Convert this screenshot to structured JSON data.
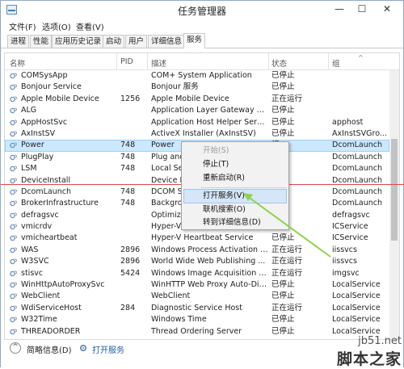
{
  "window": {
    "title": "任务管理器",
    "controls": {
      "minimize": "—",
      "maximize": "☐",
      "close": "✕"
    }
  },
  "menubar": [
    "文件(F)",
    "选项(O)",
    "查看(V)"
  ],
  "tabs": [
    {
      "label": "进程",
      "active": false
    },
    {
      "label": "性能",
      "active": false
    },
    {
      "label": "应用历史记录",
      "active": false
    },
    {
      "label": "启动",
      "active": false
    },
    {
      "label": "用户",
      "active": false
    },
    {
      "label": "详细信息",
      "active": false
    },
    {
      "label": "服务",
      "active": true
    }
  ],
  "columns": {
    "name": "名称",
    "pid": "PID",
    "desc": "描述",
    "status": "状态",
    "group": "组"
  },
  "rows": [
    {
      "name": "COMSysApp",
      "pid": "",
      "desc": "COM+ System Application",
      "status": "已停止",
      "group": ""
    },
    {
      "name": "Bonjour Service",
      "pid": "",
      "desc": "Bonjour 服务",
      "status": "已停止",
      "group": ""
    },
    {
      "name": "Apple Mobile Device",
      "pid": "1256",
      "desc": "Apple Mobile Device",
      "status": "正在运行",
      "group": ""
    },
    {
      "name": "ALG",
      "pid": "",
      "desc": "Application Layer Gateway Se...",
      "status": "已停止",
      "group": ""
    },
    {
      "name": "AppHostSvc",
      "pid": "",
      "desc": "Application Host Helper Servi...",
      "status": "已停止",
      "group": "apphost"
    },
    {
      "name": "AxInstSV",
      "pid": "",
      "desc": "ActiveX Installer (AxInstSV)",
      "status": "已停止",
      "group": "AxInstSVGro..."
    },
    {
      "name": "Power",
      "pid": "748",
      "desc": "Power",
      "status": "行",
      "group": "DcomLaunch",
      "selected": true
    },
    {
      "name": "PlugPlay",
      "pid": "748",
      "desc": "Plug and",
      "status": "行",
      "group": "DcomLaunch"
    },
    {
      "name": "LSM",
      "pid": "748",
      "desc": "Local Se",
      "status": "行",
      "group": "DcomLaunch"
    },
    {
      "name": "DeviceInstall",
      "pid": "",
      "desc": "Device In",
      "status": "",
      "group": "DcomLaunch"
    },
    {
      "name": "DcomLaunch",
      "pid": "748",
      "desc": "DCOM S",
      "status": "行",
      "group": "DcomLaunch"
    },
    {
      "name": "BrokerInfrastructure",
      "pid": "748",
      "desc": "Backgro",
      "status": "行",
      "group": "DcomLaunch"
    },
    {
      "name": "defragsvc",
      "pid": "",
      "desc": "Optimize",
      "status": "",
      "group": "defragsvc"
    },
    {
      "name": "vmicrdv",
      "pid": "",
      "desc": "Hyper-V",
      "status": "",
      "group": "ICService"
    },
    {
      "name": "vmicheartbeat",
      "pid": "",
      "desc": "Hyper-V Heartbeat Service",
      "status": "已停止",
      "group": "ICService"
    },
    {
      "name": "WAS",
      "pid": "2896",
      "desc": "Windows Process Activation S...",
      "status": "正在运行",
      "group": "iissvcs"
    },
    {
      "name": "W3SVC",
      "pid": "2896",
      "desc": "World Wide Web Publishing ...",
      "status": "正在运行",
      "group": "iissvcs"
    },
    {
      "name": "stisvc",
      "pid": "5424",
      "desc": "Windows Image Acquisition (...",
      "status": "正在运行",
      "group": "imgsvc"
    },
    {
      "name": "WinHttpAutoProxySvc",
      "pid": "",
      "desc": "WinHTTP Web Proxy Auto-Dis...",
      "status": "已停止",
      "group": "LocalService"
    },
    {
      "name": "WebClient",
      "pid": "",
      "desc": "WebClient",
      "status": "已停止",
      "group": "LocalService"
    },
    {
      "name": "WdiServiceHost",
      "pid": "284",
      "desc": "Diagnostic Service Host",
      "status": "正在运行",
      "group": "LocalService"
    },
    {
      "name": "W32Time",
      "pid": "",
      "desc": "Windows Time",
      "status": "已停止",
      "group": "LocalService"
    },
    {
      "name": "THREADORDER",
      "pid": "",
      "desc": "Thread Ordering Server",
      "status": "已停止",
      "group": "LocalService"
    }
  ],
  "context_menu": [
    {
      "label": "开始(S)",
      "disabled": true
    },
    {
      "label": "停止(T)",
      "disabled": false
    },
    {
      "label": "重新启动(R)",
      "disabled": false
    },
    {
      "label": "打开服务(V)",
      "disabled": false,
      "highlighted": true
    },
    {
      "label": "联机搜索(O)",
      "disabled": false
    },
    {
      "label": "转到详细信息(D)",
      "disabled": false
    }
  ],
  "footer": {
    "less_details": "简略信息(D)",
    "open_services": "打开服务"
  },
  "watermark": {
    "url": "jb51.net",
    "text": "脚本之家"
  },
  "colors": {
    "accent": "#1e5ea8",
    "selected_row": "#cce8ff",
    "annotation_arrow": "#8fd14f",
    "annotation_line": "#e04646"
  }
}
